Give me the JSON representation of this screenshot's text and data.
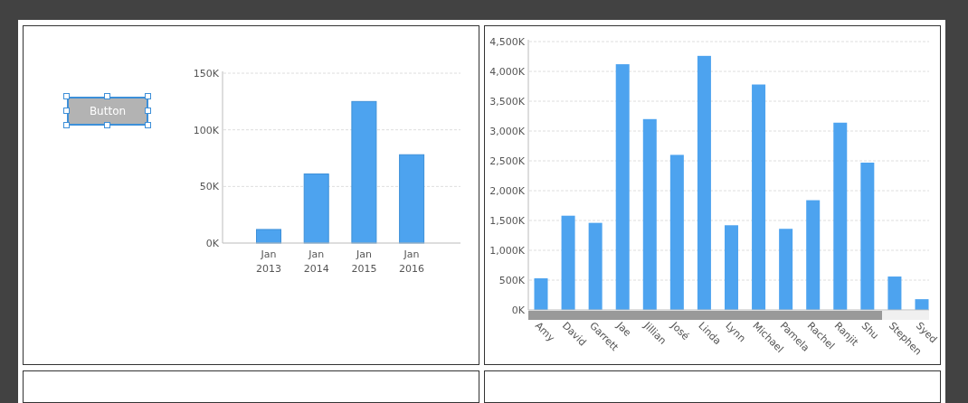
{
  "panels": [
    {
      "kind": "designer",
      "button": {
        "label": "Button",
        "selected": true
      },
      "chart_data": {
        "type": "bar",
        "categories": [
          "Jan 2013",
          "Jan 2014",
          "Jan 2015",
          "Jan 2016"
        ],
        "values": [
          12,
          61,
          125,
          78
        ],
        "ylim": [
          0,
          150
        ],
        "grid": true,
        "yticks": [
          {
            "value": 0,
            "label": "0K"
          },
          {
            "value": 50,
            "label": "50K"
          },
          {
            "value": 100,
            "label": "100K"
          },
          {
            "value": 150,
            "label": "150K"
          }
        ]
      }
    },
    {
      "kind": "chart",
      "chart_data": {
        "type": "bar",
        "categories": [
          "Amy",
          "David",
          "Garrett",
          "Jae",
          "Jillian",
          "José",
          "Linda",
          "Lynn",
          "Michael",
          "Pamela",
          "Rachel",
          "Ranjit",
          "Shu",
          "Stephen",
          "Syed"
        ],
        "values": [
          530,
          1580,
          1460,
          4120,
          3200,
          2600,
          4260,
          1420,
          3780,
          1360,
          1840,
          3140,
          2470,
          560,
          180
        ],
        "ylim": [
          0,
          4500
        ],
        "grid": true,
        "yticks": [
          {
            "value": 0,
            "label": "0K"
          },
          {
            "value": 500,
            "label": "500K"
          },
          {
            "value": 1000,
            "label": "1,000K"
          },
          {
            "value": 1500,
            "label": "1,500K"
          },
          {
            "value": 2000,
            "label": "2,000K"
          },
          {
            "value": 2500,
            "label": "2,500K"
          },
          {
            "value": 3000,
            "label": "3,000K"
          },
          {
            "value": 3500,
            "label": "3,500K"
          },
          {
            "value": 4000,
            "label": "4,000K"
          },
          {
            "value": 4500,
            "label": "4,500K"
          }
        ]
      }
    },
    {
      "kind": "empty"
    },
    {
      "kind": "empty"
    }
  ]
}
